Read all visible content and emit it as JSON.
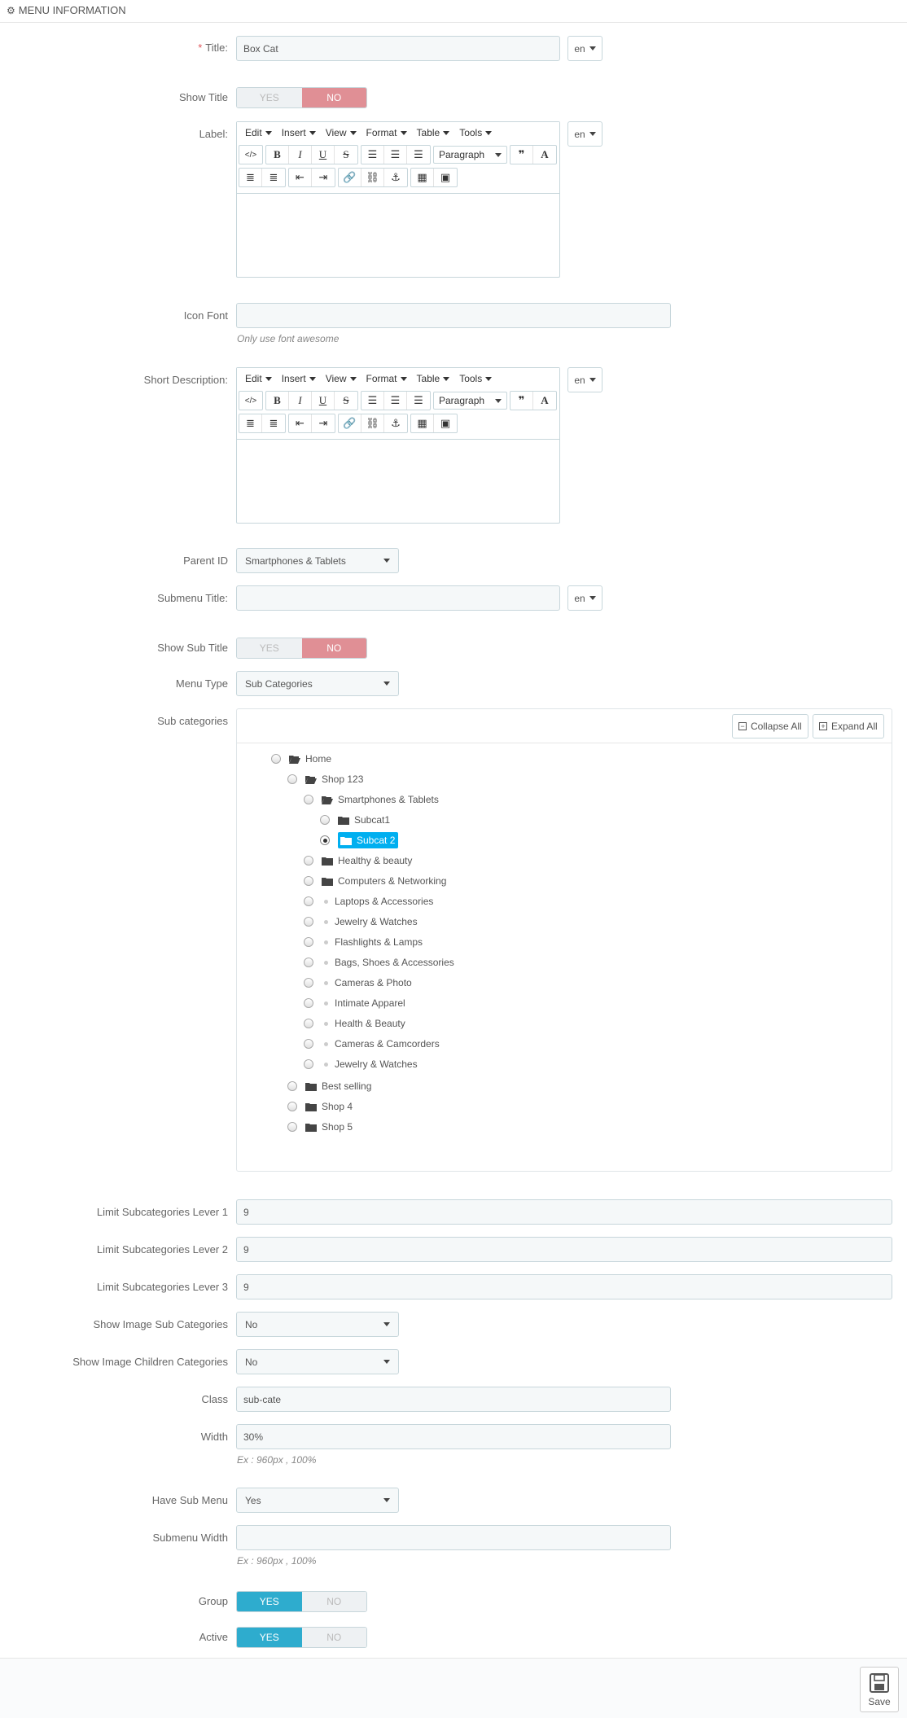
{
  "header": {
    "title": "MENU INFORMATION"
  },
  "lang": "en",
  "fields": {
    "title": {
      "label": "Title:",
      "value": "Box Cat"
    },
    "show_title": {
      "label": "Show Title",
      "yes": "YES",
      "no": "NO",
      "active": "NO"
    },
    "label_editor": {
      "label": "Label:"
    },
    "icon_font": {
      "label": "Icon Font",
      "value": "",
      "hint": "Only use font awesome"
    },
    "short_desc": {
      "label": "Short Description:"
    },
    "parent_id": {
      "label": "Parent ID",
      "value": "Smartphones & Tablets"
    },
    "submenu_title": {
      "label": "Submenu Title:",
      "value": ""
    },
    "show_sub_title": {
      "label": "Show Sub Title",
      "yes": "YES",
      "no": "NO",
      "active": "NO"
    },
    "menu_type": {
      "label": "Menu Type",
      "value": "Sub Categories"
    },
    "sub_categories": {
      "label": "Sub categories"
    },
    "limit1": {
      "label": "Limit Subcategories Lever 1",
      "value": "9"
    },
    "limit2": {
      "label": "Limit Subcategories Lever 2",
      "value": "9"
    },
    "limit3": {
      "label": "Limit Subcategories Lever 3",
      "value": "9"
    },
    "show_image_sub": {
      "label": "Show Image Sub Categories",
      "value": "No"
    },
    "show_image_children": {
      "label": "Show Image Children Categories",
      "value": "No"
    },
    "class": {
      "label": "Class",
      "value": "sub-cate"
    },
    "width": {
      "label": "Width",
      "value": "30%",
      "hint": "Ex : 960px , 100%"
    },
    "have_sub_menu": {
      "label": "Have Sub Menu",
      "value": "Yes"
    },
    "submenu_width": {
      "label": "Submenu Width",
      "value": "",
      "hint": "Ex : 960px , 100%"
    },
    "group": {
      "label": "Group",
      "yes": "YES",
      "no": "NO",
      "active": "YES"
    },
    "active": {
      "label": "Active",
      "yes": "YES",
      "no": "NO",
      "active": "YES"
    }
  },
  "editor": {
    "menus": [
      "Edit",
      "Insert",
      "View",
      "Format",
      "Table",
      "Tools"
    ],
    "paragraph": "Paragraph"
  },
  "tree": {
    "collapse_all": "Collapse All",
    "expand_all": "Expand All",
    "nodes": [
      {
        "label": "Home",
        "type": "folder-open"
      },
      {
        "label": "Shop 123",
        "type": "folder-open"
      },
      {
        "label": "Smartphones & Tablets",
        "type": "folder-open"
      },
      {
        "label": "Subcat1",
        "type": "folder"
      },
      {
        "label": "Subcat 2",
        "type": "folder",
        "selected": true
      },
      {
        "label": "Healthy & beauty",
        "type": "folder"
      },
      {
        "label": "Computers & Networking",
        "type": "folder"
      },
      {
        "label": "Laptops & Accessories",
        "type": "leaf"
      },
      {
        "label": "Jewelry & Watches",
        "type": "leaf"
      },
      {
        "label": "Flashlights & Lamps",
        "type": "leaf"
      },
      {
        "label": "Bags, Shoes & Accessories",
        "type": "leaf"
      },
      {
        "label": "Cameras & Photo",
        "type": "leaf"
      },
      {
        "label": "Intimate Apparel",
        "type": "leaf"
      },
      {
        "label": "Health & Beauty",
        "type": "leaf"
      },
      {
        "label": "Cameras & Camcorders",
        "type": "leaf"
      },
      {
        "label": "Jewelry & Watches",
        "type": "leaf"
      },
      {
        "label": "Best selling",
        "type": "folder"
      },
      {
        "label": "Shop 4",
        "type": "folder"
      },
      {
        "label": "Shop 5",
        "type": "folder"
      }
    ]
  },
  "footer": {
    "save": "Save"
  },
  "colors": {
    "toggle_no": "#e08f95",
    "toggle_yes": "#2eacce",
    "selected_node": "#00aff0"
  }
}
